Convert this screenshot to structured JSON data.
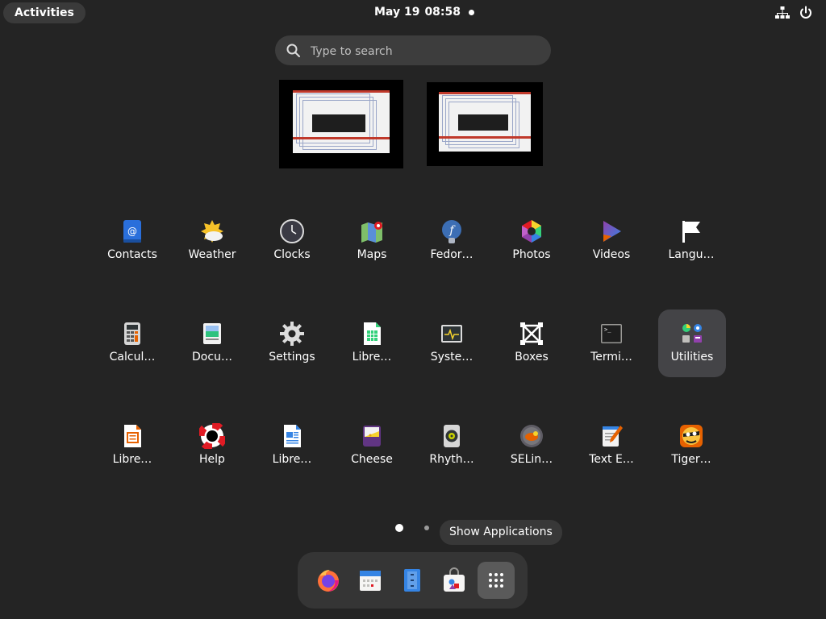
{
  "topbar": {
    "activities": "Activities",
    "date": "May 19",
    "time": "08:58",
    "network_icon": "network-icon",
    "power_icon": "power-icon"
  },
  "search": {
    "placeholder": "Type to search"
  },
  "apps": [
    {
      "label": "Contacts",
      "icon": "contacts-icon"
    },
    {
      "label": "Weather",
      "icon": "weather-icon"
    },
    {
      "label": "Clocks",
      "icon": "clocks-icon"
    },
    {
      "label": "Maps",
      "icon": "maps-icon"
    },
    {
      "label": "Fedor…",
      "icon": "fedora-icon"
    },
    {
      "label": "Photos",
      "icon": "photos-icon"
    },
    {
      "label": "Videos",
      "icon": "videos-icon"
    },
    {
      "label": "Langu…",
      "icon": "language-flag-icon"
    },
    {
      "label": "Calcul…",
      "icon": "calculator-icon"
    },
    {
      "label": "Docu…",
      "icon": "document-viewer-icon"
    },
    {
      "label": "Settings",
      "icon": "gear-icon"
    },
    {
      "label": "Libre…",
      "icon": "libreoffice-calc-icon"
    },
    {
      "label": "Syste…",
      "icon": "system-monitor-icon"
    },
    {
      "label": "Boxes",
      "icon": "boxes-icon"
    },
    {
      "label": "Termi…",
      "icon": "terminal-icon"
    },
    {
      "label": "Utilities",
      "icon": "utilities-folder-icon"
    },
    {
      "label": "Libre…",
      "icon": "libreoffice-impress-icon"
    },
    {
      "label": "Help",
      "icon": "help-lifebuoy-icon"
    },
    {
      "label": "Libre…",
      "icon": "libreoffice-writer-icon"
    },
    {
      "label": "Cheese",
      "icon": "cheese-icon"
    },
    {
      "label": "Rhyth…",
      "icon": "rhythmbox-icon"
    },
    {
      "label": "SELin…",
      "icon": "selinux-icon"
    },
    {
      "label": "Text E…",
      "icon": "text-editor-icon"
    },
    {
      "label": "Tiger…",
      "icon": "tigervnc-icon"
    }
  ],
  "tooltip": "Show Applications",
  "dock": [
    {
      "name": "firefox-icon"
    },
    {
      "name": "calendar-icon"
    },
    {
      "name": "files-icon"
    },
    {
      "name": "software-icon"
    },
    {
      "name": "show-applications-icon"
    }
  ]
}
